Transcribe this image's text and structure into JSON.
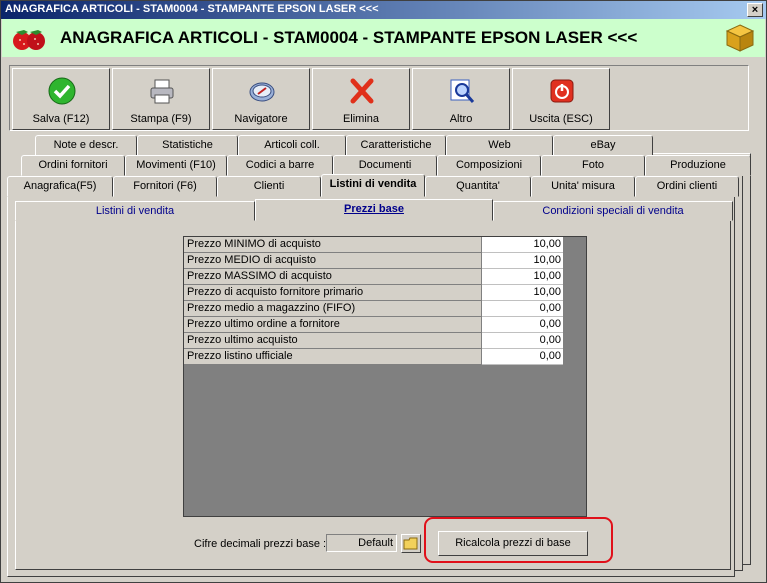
{
  "window": {
    "title": "ANAGRAFICA ARTICOLI - STAM0004 - STAMPANTE EPSON LASER <<<",
    "close_label": "×"
  },
  "header": {
    "title": "ANAGRAFICA ARTICOLI - STAM0004 - STAMPANTE EPSON LASER <<<",
    "bg_color": "#ccffcc"
  },
  "toolbar": {
    "buttons": [
      {
        "label": "Salva (F12)",
        "icon": "checkmark-icon"
      },
      {
        "label": "Stampa (F9)",
        "icon": "printer-icon"
      },
      {
        "label": "Navigatore",
        "icon": "compass-icon"
      },
      {
        "label": "Elimina",
        "icon": "delete-x-icon"
      },
      {
        "label": "Altro",
        "icon": "magnifier-icon"
      },
      {
        "label": "Uscita (ESC)",
        "icon": "power-icon"
      }
    ]
  },
  "tabs": {
    "row1": [
      "Note e descr.",
      "Statistiche",
      "Articoli coll.",
      "Caratteristiche",
      "Web",
      "eBay"
    ],
    "row2": [
      "Ordini fornitori",
      "Movimenti (F10)",
      "Codici a barre",
      "Documenti",
      "Composizioni",
      "Foto",
      "Produzione"
    ],
    "row3": [
      "Anagrafica(F5)",
      "Fornitori (F6)",
      "Clienti",
      "Listini di vendita",
      "Quantita'",
      "Unita' misura",
      "Ordini clienti"
    ],
    "active": "Listini di vendita"
  },
  "subtabs": {
    "items": [
      "Listini di vendita",
      "Prezzi base",
      "Condizioni speciali di vendita"
    ],
    "active": "Prezzi base"
  },
  "prices": [
    {
      "label": "Prezzo MINIMO di acquisto",
      "value": "10,00"
    },
    {
      "label": "Prezzo MEDIO di acquisto",
      "value": "10,00"
    },
    {
      "label": "Prezzo MASSIMO di acquisto",
      "value": "10,00"
    },
    {
      "label": "Prezzo di acquisto fornitore primario",
      "value": "10,00"
    },
    {
      "label": "Prezzo medio a magazzino (FIFO)",
      "value": "0,00"
    },
    {
      "label": "Prezzo ultimo ordine a fornitore",
      "value": "0,00"
    },
    {
      "label": "Prezzo ultimo acquisto",
      "value": "0,00"
    },
    {
      "label": "Prezzo listino ufficiale",
      "value": "0,00"
    }
  ],
  "footer": {
    "decimals_label": "Cifre decimali prezzi base :",
    "decimals_value": "Default",
    "recalc_label": "Ricalcola prezzi di base",
    "highlight_color": "#e0101a"
  }
}
